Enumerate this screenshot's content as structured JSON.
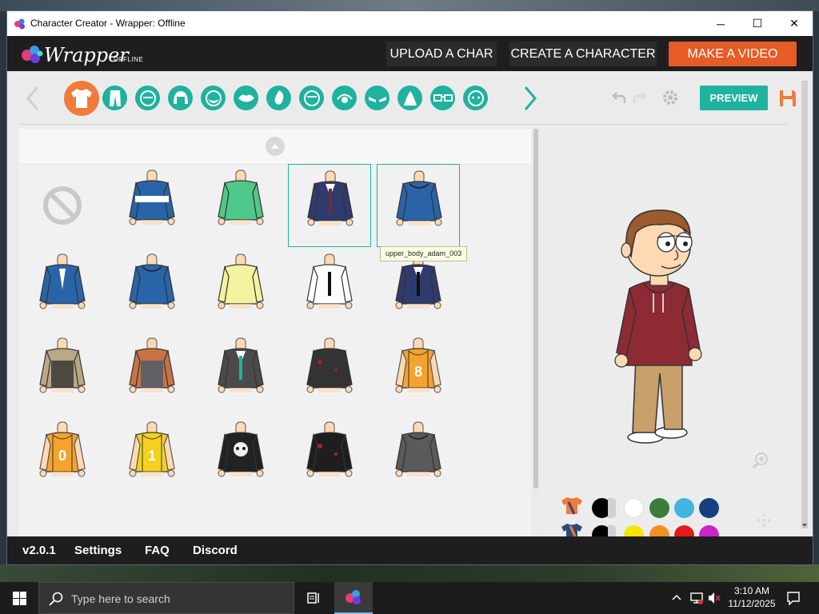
{
  "window": {
    "title": "Character Creator - Wrapper: Offline",
    "minimize_glyph": "─",
    "maximize_glyph": "☐",
    "close_glyph": "✕"
  },
  "header": {
    "logo_text": "Wrapper",
    "logo_subtext": "OFFLINE",
    "buttons": [
      "UPLOAD A CHAR",
      "CREATE A CHARACTER",
      "MAKE A VIDEO"
    ],
    "accent_color": "#e65c26"
  },
  "toolbar": {
    "categories": [
      {
        "name": "upper-body",
        "icon": "shirt-icon",
        "active": true
      },
      {
        "name": "lower-body",
        "icon": "pants-icon"
      },
      {
        "name": "head",
        "icon": "face-icon"
      },
      {
        "name": "hair",
        "icon": "hair-icon"
      },
      {
        "name": "face-shape",
        "icon": "beard-icon"
      },
      {
        "name": "mouth",
        "icon": "mouth-icon"
      },
      {
        "name": "nose",
        "icon": "nose-icon"
      },
      {
        "name": "ears",
        "icon": "head-outline-icon"
      },
      {
        "name": "eyes",
        "icon": "eye-icon"
      },
      {
        "name": "eyebrows",
        "icon": "eyebrows-icon"
      },
      {
        "name": "skin",
        "icon": "triangle-icon"
      },
      {
        "name": "glasses",
        "icon": "glasses-icon"
      },
      {
        "name": "accessory",
        "icon": "mask-icon"
      }
    ],
    "preview_label": "PREVIEW",
    "accent_color": "#1fb29e",
    "active_color": "#f07b3a"
  },
  "tooltip": "upper_body_adam_003",
  "outfits": [
    {
      "kind": "none"
    },
    {
      "kind": "shirt",
      "color": "#2a64a8",
      "accent": "#ffffff"
    },
    {
      "kind": "shirt",
      "color": "#4fc98a"
    },
    {
      "kind": "suit",
      "color": "#2f3a6e",
      "accent": "#7a2a2a",
      "selected": true
    },
    {
      "kind": "hoodie",
      "color": "#2a64a8",
      "selected": true
    },
    {
      "kind": "uniform",
      "color": "#2a64a8",
      "accent": "#ffffff"
    },
    {
      "kind": "puffer",
      "color": "#2a64a8"
    },
    {
      "kind": "shirt",
      "color": "#f3f3a0"
    },
    {
      "kind": "dress",
      "color": "#ffffff",
      "accent": "#111111"
    },
    {
      "kind": "suit",
      "color": "#2f3a6e",
      "accent": "#111111"
    },
    {
      "kind": "camo",
      "color": "#b9a886",
      "accent": "#2a2a2a"
    },
    {
      "kind": "apron",
      "color": "#c87345",
      "accent": "#3f5a72"
    },
    {
      "kind": "suit",
      "color": "#4a4a4a",
      "accent": "#1fb29e"
    },
    {
      "kind": "zombie",
      "color": "#333333",
      "accent": "#a32020"
    },
    {
      "kind": "jersey",
      "color": "#f4a32e",
      "number": "8"
    },
    {
      "kind": "jersey",
      "color": "#f4a32e",
      "number": "0"
    },
    {
      "kind": "jersey",
      "color": "#f4d11e",
      "number": "1"
    },
    {
      "kind": "skull",
      "color": "#222222"
    },
    {
      "kind": "leather",
      "color": "#1e1e1e",
      "accent": "#b02020"
    },
    {
      "kind": "hoodie",
      "color": "#5a5a5a"
    }
  ],
  "colors": {
    "row1": [
      "#000000",
      "#ffffff",
      "#3a7d3a",
      "#3fb6e0",
      "#153f7e"
    ],
    "row2": [
      "#000000",
      "#f5e600",
      "#f4901e",
      "#e51919",
      "#cc22cc"
    ]
  },
  "character": {
    "hoodie_color": "#8e2a34",
    "pants_color": "#c8a06a",
    "hair_color": "#9b5b2e",
    "skin_color": "#ffd9b3"
  },
  "footer": {
    "links": [
      "v2.0.1",
      "Settings",
      "FAQ",
      "Discord"
    ]
  },
  "taskbar": {
    "search_placeholder": "Type here to search",
    "time": "3:10 AM",
    "date": "11/12/2025"
  }
}
